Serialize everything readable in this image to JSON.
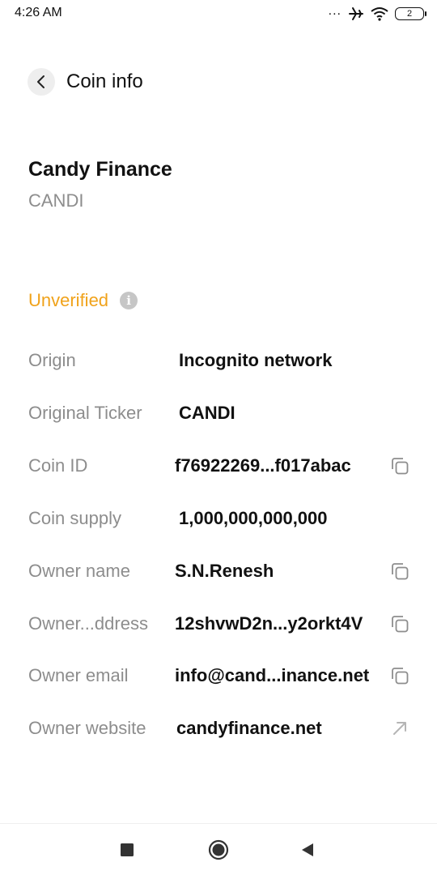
{
  "status_bar": {
    "time": "4:26 AM",
    "dots": "...",
    "battery_level": "2",
    "icons": [
      "airplane-icon",
      "wifi-icon",
      "battery-icon"
    ]
  },
  "header": {
    "title": "Coin info",
    "back_icon": "chevron-left-icon"
  },
  "coin": {
    "name": "Candy Finance",
    "ticker": "CANDI",
    "verification_status": "Unverified",
    "verification_color": "#f0a21a"
  },
  "details": [
    {
      "label": "Origin",
      "value": "Incognito network",
      "action": ""
    },
    {
      "label": "Original Ticker",
      "value": "CANDI",
      "action": ""
    },
    {
      "label": "Coin ID",
      "value": "f76922269...f017abac",
      "action": "copy-icon"
    },
    {
      "label": "Coin supply",
      "value": "1,000,000,000,000",
      "action": ""
    },
    {
      "label": "Owner name",
      "value": "S.N.Renesh",
      "action": "copy-icon"
    },
    {
      "label": "Owner...ddress",
      "value": "12shvwD2n...y2orkt4V",
      "action": "copy-icon"
    },
    {
      "label": "Owner email",
      "value": "info@cand...inance.net",
      "action": "copy-icon"
    },
    {
      "label": "Owner website",
      "value": "candyfinance.net",
      "action": "open-link-icon"
    }
  ],
  "nav_bar": {
    "buttons": [
      "recents-square-icon",
      "home-circle-icon",
      "back-triangle-icon"
    ]
  },
  "colors": {
    "label_gray": "#8d8d8d",
    "accent_orange": "#f0a21a"
  }
}
